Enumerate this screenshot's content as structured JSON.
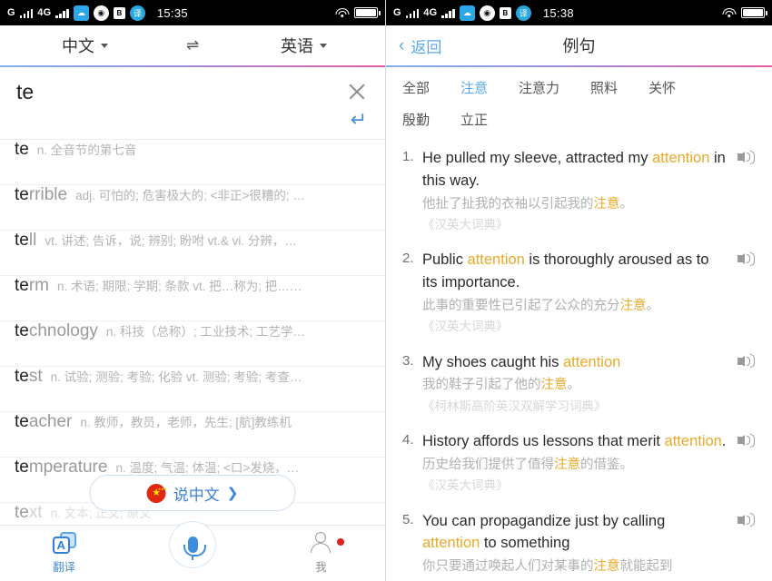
{
  "status_bar": {
    "carrier": "G",
    "network": "4G",
    "time_left": "15:35",
    "time_right": "15:38",
    "icons": [
      "cloud-icon",
      "shield-icon",
      "box-icon",
      "translate-app-icon",
      "wifi-icon",
      "battery-icon"
    ],
    "translate_glyph": "译",
    "box_glyph": "B"
  },
  "left_panel": {
    "header": {
      "source_lang": "中文",
      "swap_icon": "⇌",
      "target_lang": "英语"
    },
    "search": {
      "value": "te",
      "placeholder": "",
      "clear_icon": "close-icon",
      "enter_icon": "↵"
    },
    "suggestions": [
      {
        "match": "te",
        "rest": "",
        "def": "n. 全音节的第七音"
      },
      {
        "match": "te",
        "rest": "rrible",
        "def": "adj. 可怕的; 危害极大的; <非正>很糟的; …"
      },
      {
        "match": "te",
        "rest": "ll",
        "def": "vt. 讲述; 告诉，说; 辨别; 盼咐 vt.& vi. 分辨，…"
      },
      {
        "match": "te",
        "rest": "rm",
        "def": "n. 术语; 期限; 学期; 条款 vt. 把…称为; 把……"
      },
      {
        "match": "te",
        "rest": "chnology",
        "def": "n. 科技（总称）; 工业技术; 工艺学…"
      },
      {
        "match": "te",
        "rest": "st",
        "def": "n. 试验; 测验; 考验; 化验 vt. 测验; 考验; 考查…"
      },
      {
        "match": "te",
        "rest": "acher",
        "def": "n. 教师，教员，老师，先生; [航]教练机"
      },
      {
        "match": "te",
        "rest": "mperature",
        "def": "n. 温度; 气温; 体温; <口>发烧，…"
      },
      {
        "match": "te",
        "rest": "xt",
        "def": "n. 文本; 正文; 原文"
      }
    ],
    "speak_button": {
      "flag_icon": "china-flag-icon",
      "flag_glyph": "★",
      "label": "说中文",
      "arrow": "❯"
    },
    "tabbar": [
      {
        "icon": "translate-icon",
        "glyph": "A",
        "label": "翻译",
        "active": true
      },
      {
        "icon": "microphone-icon",
        "label": "",
        "active": false
      },
      {
        "icon": "profile-icon",
        "label": "我",
        "active": false,
        "badge": true
      }
    ]
  },
  "right_panel": {
    "header": {
      "back_icon": "chevron-left-icon",
      "back_label": "返回",
      "title": "例句"
    },
    "chips": [
      {
        "label": "全部",
        "active": false
      },
      {
        "label": "注意",
        "active": true
      },
      {
        "label": "注意力",
        "active": false
      },
      {
        "label": "照料",
        "active": false
      },
      {
        "label": "关怀",
        "active": false
      },
      {
        "label": "殷勤",
        "active": false
      },
      {
        "label": "立正",
        "active": false
      }
    ],
    "sentences": [
      {
        "num": "1.",
        "en_parts": [
          {
            "t": "He pulled my sleeve, attracted my ",
            "hl": false
          },
          {
            "t": "attention",
            "hl": true
          },
          {
            "t": " in this way.",
            "hl": false
          }
        ],
        "cn_parts": [
          {
            "t": "他扯了扯我的衣袖以引起我的",
            "hl": false
          },
          {
            "t": "注意",
            "hl": true
          },
          {
            "t": "。",
            "hl": false
          }
        ],
        "source": "《汉英大词典》",
        "speaker_icon": "speaker-icon"
      },
      {
        "num": "2.",
        "en_parts": [
          {
            "t": "Public ",
            "hl": false
          },
          {
            "t": "attention",
            "hl": true
          },
          {
            "t": " is thoroughly aroused as to its importance.",
            "hl": false
          }
        ],
        "cn_parts": [
          {
            "t": "此事的重要性已引起了公众的充分",
            "hl": false
          },
          {
            "t": "注意",
            "hl": true
          },
          {
            "t": "。",
            "hl": false
          }
        ],
        "source": "《汉英大词典》",
        "speaker_icon": "speaker-icon"
      },
      {
        "num": "3.",
        "en_parts": [
          {
            "t": "My shoes caught his ",
            "hl": false
          },
          {
            "t": "attention",
            "hl": true
          }
        ],
        "cn_parts": [
          {
            "t": "我的鞋子引起了他的",
            "hl": false
          },
          {
            "t": "注意",
            "hl": true
          },
          {
            "t": "。",
            "hl": false
          }
        ],
        "source": "《柯林斯高阶英汉双解学习词典》",
        "speaker_icon": "speaker-icon"
      },
      {
        "num": "4.",
        "en_parts": [
          {
            "t": "History affords us lessons that merit ",
            "hl": false
          },
          {
            "t": "attention",
            "hl": true
          },
          {
            "t": ".",
            "hl": false
          }
        ],
        "cn_parts": [
          {
            "t": "历史给我们提供了值得",
            "hl": false
          },
          {
            "t": "注意",
            "hl": true
          },
          {
            "t": "的借鉴。",
            "hl": false
          }
        ],
        "source": "《汉英大词典》",
        "speaker_icon": "speaker-icon"
      },
      {
        "num": "5.",
        "en_parts": [
          {
            "t": "You can propagandize just by calling ",
            "hl": false
          },
          {
            "t": "attention",
            "hl": true
          },
          {
            "t": " to something",
            "hl": false
          }
        ],
        "cn_parts": [
          {
            "t": "你只要通过唤起人们对某事的",
            "hl": false
          },
          {
            "t": "注意",
            "hl": true
          },
          {
            "t": "就能起到",
            "hl": false
          }
        ],
        "source": "",
        "speaker_icon": "speaker-icon"
      }
    ]
  },
  "colors": {
    "accent_blue": "#5aa7e8",
    "highlight_orange": "#e8aa28",
    "grad_start": "#7fb0ee",
    "grad_end": "#e95fa0",
    "badge_red": "#e02020"
  }
}
